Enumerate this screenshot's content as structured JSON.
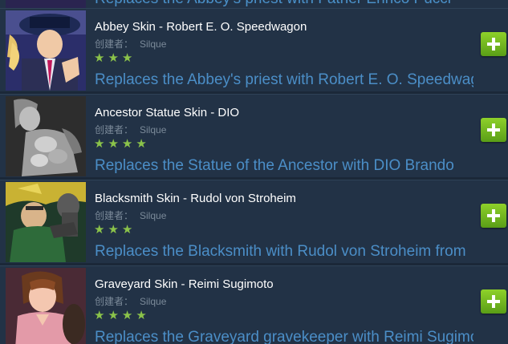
{
  "creator_label": "创建者：",
  "colors": {
    "background": "#1b2838",
    "row": "#223246",
    "title": "#ffffff",
    "description": "#4b8ec7",
    "stars": "#8bc34a",
    "button": "#6fb51f"
  },
  "top_partial": {
    "description": "Replaces the Abbey's priest with Father Enrico Pucci"
  },
  "items": [
    {
      "title": "Abbey Skin - Robert E. O. Speedwagon",
      "author": "Silque",
      "rating": 3,
      "stars": "★★★",
      "description": "Replaces the Abbey's priest with Robert E. O. Speedwagon",
      "thumbnail_icon": "speedwagon-thumbnail",
      "button_icon": "plus-icon"
    },
    {
      "title": "Ancestor Statue Skin - DIO",
      "author": "Silque",
      "rating": 4,
      "stars": "★★★★",
      "description": "Replaces the Statue of the Ancestor with DIO Brando",
      "thumbnail_icon": "dio-thumbnail",
      "button_icon": "plus-icon"
    },
    {
      "title": "Blacksmith Skin - Rudol von Stroheim",
      "author": "Silque",
      "rating": 3,
      "stars": "★★★",
      "description": "Replaces the Blacksmith with Rudol von Stroheim from",
      "thumbnail_icon": "stroheim-thumbnail",
      "button_icon": "plus-icon"
    },
    {
      "title": "Graveyard Skin - Reimi Sugimoto",
      "author": "Silque",
      "rating": 4,
      "stars": "★★★★",
      "description": "Replaces the Graveyard gravekeeper with Reimi Sugimoto",
      "thumbnail_icon": "reimi-thumbnail",
      "button_icon": "plus-icon"
    }
  ]
}
